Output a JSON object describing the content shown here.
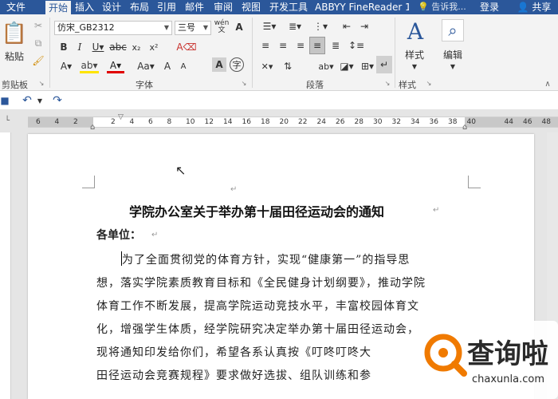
{
  "tabs": [
    {
      "label": "文件",
      "active": false
    },
    {
      "label": "开始",
      "active": true
    },
    {
      "label": "插入",
      "active": false
    },
    {
      "label": "设计",
      "active": false
    },
    {
      "label": "布局",
      "active": false
    },
    {
      "label": "引用",
      "active": false
    },
    {
      "label": "邮件",
      "active": false
    },
    {
      "label": "审阅",
      "active": false
    },
    {
      "label": "视图",
      "active": false
    },
    {
      "label": "开发工具",
      "active": false
    },
    {
      "label": "ABBYY FineReader 1",
      "active": false
    }
  ],
  "tell_me": "告诉我...",
  "login": "登录",
  "share": "共享",
  "ribbon": {
    "paste_label": "粘贴",
    "clipboard_label": "剪贴板",
    "font_name": "仿宋_GB2312",
    "font_size": "三号",
    "font_group_label": "字体",
    "paragraph_group_label": "段落",
    "styles_label": "样式",
    "styles_group_label": "样式",
    "edit_label": "编辑",
    "phonetic_label": "wén"
  },
  "ruler": {
    "ticks": [
      "6",
      "4",
      "2",
      "",
      "2",
      "4",
      "6",
      "8",
      "10",
      "12",
      "14",
      "16",
      "18",
      "20",
      "22",
      "24",
      "26",
      "28",
      "30",
      "32",
      "34",
      "36",
      "38",
      "40",
      "",
      "44",
      "46",
      "48"
    ]
  },
  "document": {
    "title": "学院办公室关于举办第十届田径运动会的通知",
    "addressee": "各单位：",
    "lines": [
      "为了全面贯彻党的体育方针，实现“健康第一”的指导思",
      "想，落实学院素质教育目标和《全民健身计划纲要》，推动学院",
      "体育工作不断发展，提高学院运动竞技水平，丰富校园体育文",
      "化，增强学生体质，经学院研究决定举办第十届田径运动会，",
      "现将通知印发给你们，希望各系认真按《叮咚叮咚大",
      "田径运动会竞赛规程》要求做好选拔、组队训练和参"
    ]
  },
  "watermark": {
    "brand": "查询啦",
    "url": "chaxunla.com"
  }
}
